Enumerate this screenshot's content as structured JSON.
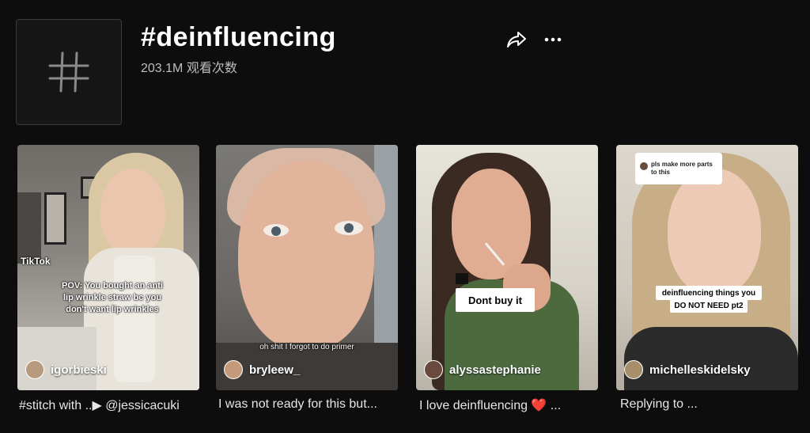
{
  "header": {
    "title": "#deinfluencing",
    "views": "203.1M 观看次数",
    "share_icon": "share-icon",
    "more_icon": "more-icon"
  },
  "videos": [
    {
      "username": "igorbieski",
      "caption": "#stitch with ..▶ @jessicacuki",
      "overlay_lines": [
        "TikTok",
        "POV: You bought an anti",
        "lip wrinkle straw bc you",
        "don't want lip wrinkles"
      ]
    },
    {
      "username": "bryleew_",
      "caption": "I was not ready for this but...",
      "overlay_lines": [
        "oh shit I forgot to do primer"
      ]
    },
    {
      "username": "alyssastephanie",
      "caption": "I love deinfluencing ❤️ ...",
      "overlay_lines": [
        "Dont buy it"
      ]
    },
    {
      "username": "michelleskidelsky",
      "caption": "Replying to ...",
      "overlay_lines": [
        "pls make more parts to this",
        "deinfluencing things you",
        "DO NOT NEED pt2"
      ]
    }
  ]
}
